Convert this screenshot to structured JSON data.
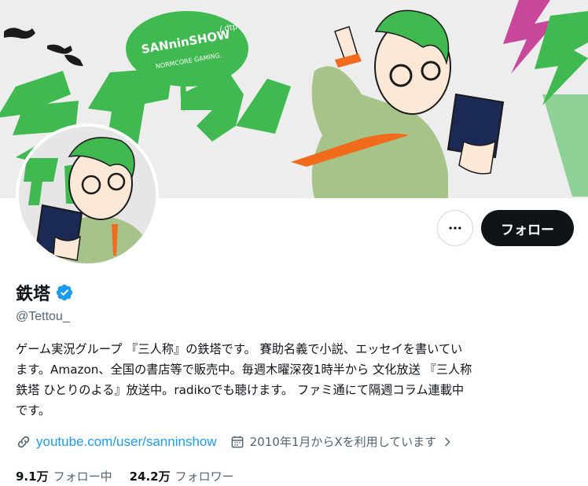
{
  "banner": {
    "logo_text": "SANninSHOW",
    "logo_suffix": "/ dtp",
    "logo_tagline": "NORMCORE GAMING.",
    "accent_green": "#3fb950",
    "accent_orange": "#f26b1d",
    "accent_pink": "#c9479a",
    "accent_navy": "#1b2a55"
  },
  "actions": {
    "more_icon": "more-horizontal-icon",
    "follow_label": "フォロー"
  },
  "profile": {
    "display_name": "鉄塔",
    "verified_icon": "verified-badge-icon",
    "verified_color": "#1d9bf0",
    "handle": "@Tettou_",
    "bio_lines": [
      "ゲーム実況グループ 『三人称』の鉄塔です。 賽助名義で小説、エッセイを書いてい",
      "ます。Amazon、全国の書店等で販売中。毎週木曜深夜1時半から 文化放送 『三人称",
      "鉄塔 ひとりのよる』放送中。radikoでも聴けます。 ファミ通にて隔週コラム連載中",
      "です。"
    ],
    "link": "youtube.com/user/sanninshow",
    "link_icon": "link-icon",
    "joined": "2010年1月からXを利用しています",
    "joined_icon": "calendar-icon",
    "joined_chevron_icon": "chevron-right-icon"
  },
  "stats": {
    "following_count": "9.1万",
    "following_label": "フォロー中",
    "followers_count": "24.2万",
    "followers_label": "フォロワー"
  }
}
